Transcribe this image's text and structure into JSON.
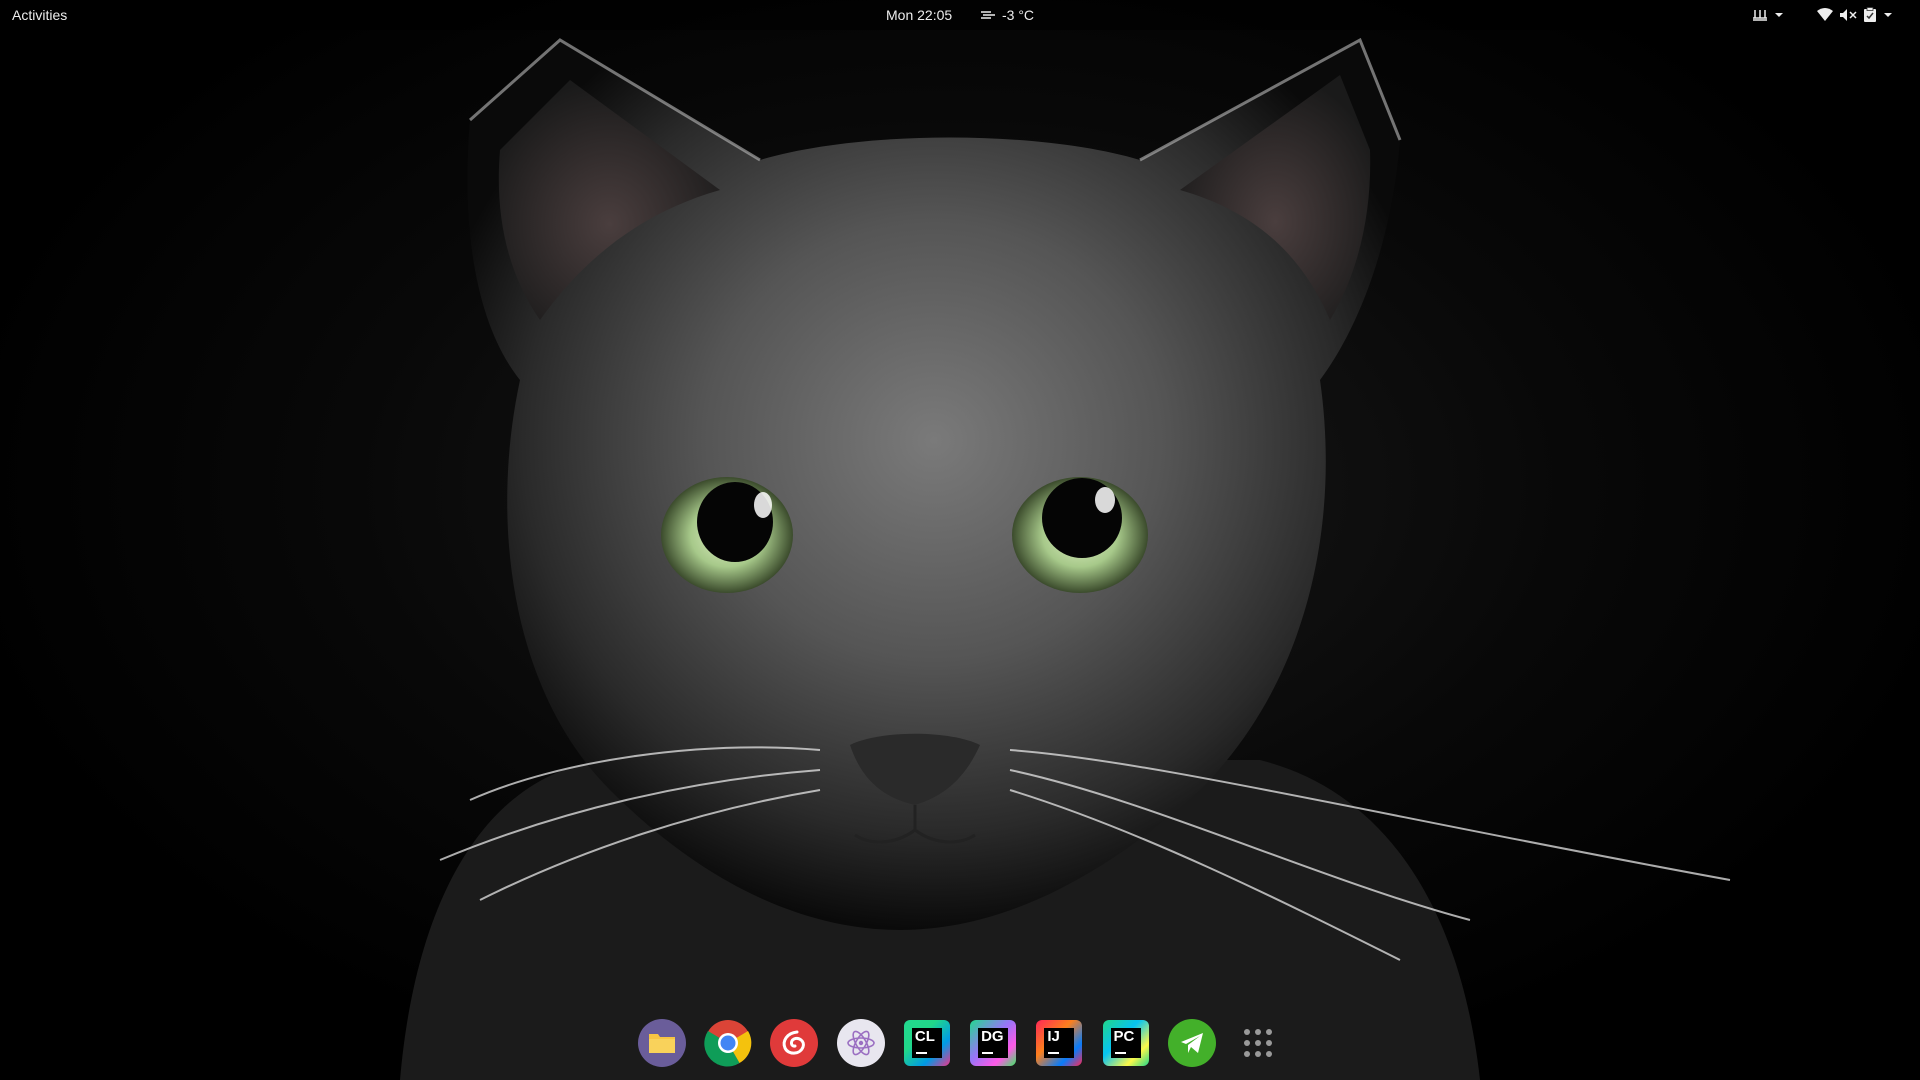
{
  "topbar": {
    "activities_label": "Activities",
    "clock": "Mon 22:05",
    "weather": "-3 °C",
    "weather_icon": "fog-icon",
    "tray": [
      "input-method-icon",
      "wifi-icon",
      "volume-muted-icon",
      "clipboard-icon"
    ]
  },
  "dock": {
    "apps": [
      {
        "name": "Files",
        "icon": "files-icon",
        "color": "#6a5d9a"
      },
      {
        "name": "Google Chrome",
        "icon": "chrome-icon",
        "color": "#db4437"
      },
      {
        "name": "NetEase Cloud Music",
        "icon": "netease-music-icon",
        "color": "#e03a3a"
      },
      {
        "name": "Atom",
        "icon": "atom-icon",
        "color": "#e8e6ef"
      },
      {
        "name": "CLion",
        "icon": "clion-icon",
        "label": "CL"
      },
      {
        "name": "DataGrip",
        "icon": "datagrip-icon",
        "label": "DG"
      },
      {
        "name": "IntelliJ IDEA",
        "icon": "intellij-icon",
        "label": "IJ"
      },
      {
        "name": "PyCharm",
        "icon": "pycharm-icon",
        "label": "PC"
      },
      {
        "name": "Telegram",
        "icon": "telegram-icon",
        "color": "#43b02a"
      },
      {
        "name": "Show Applications",
        "icon": "app-grid-icon"
      }
    ]
  },
  "colors": {
    "background": "#000000",
    "topbar_text": "#eeeeee",
    "cat_fur": "#5a5a5a",
    "cat_eyes": "#a7c98a"
  }
}
